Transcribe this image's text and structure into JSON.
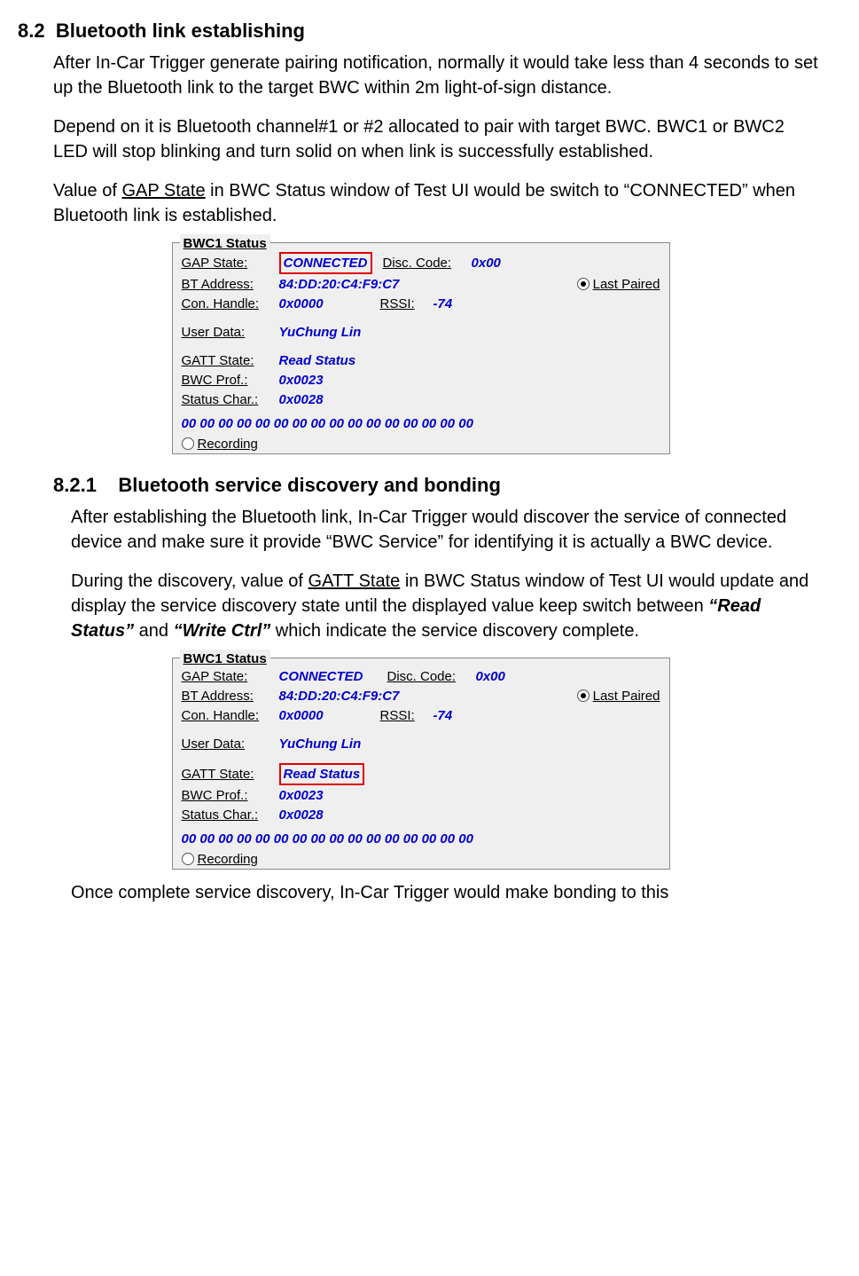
{
  "sections": {
    "s82_num": "8.2",
    "s82_title": "Bluetooth link establishing",
    "s82_p1": "After In-Car Trigger generate pairing notification, normally it would take less than 4 seconds to set up the Bluetooth link to the target BWC within 2m light-of-sign distance.",
    "s82_p2": "Depend on it is Bluetooth channel#1 or #2 allocated to pair with target BWC. BWC1 or BWC2 LED will stop blinking and turn solid on when link is successfully established.",
    "s82_p3a": "Value of ",
    "s82_p3_gap": "GAP State",
    "s82_p3b": " in BWC Status window of Test UI would be switch to “CONNECTED” when Bluetooth link is established.",
    "s821_num": "8.2.1",
    "s821_title": "Bluetooth service discovery and bonding",
    "s821_p1": "After establishing the Bluetooth link, In-Car Trigger would discover the service of connected device and make sure it provide “BWC Service” for identifying it is actually a BWC device.",
    "s821_p2a": "During the discovery, value of ",
    "s821_p2_gatt": "GATT State",
    "s821_p2b": " in BWC Status window of Test UI would update and display the service discovery state until the displayed value keep switch between ",
    "s821_p2_rs": "“Read Status”",
    "s821_p2c": " and ",
    "s821_p2_wc": "“Write Ctrl”",
    "s821_p2d": " which indicate the service discovery complete.",
    "s821_p3": "Once complete service discovery, In-Car Trigger would make bonding to this"
  },
  "panel": {
    "legend": "BWC1 Status",
    "labels": {
      "gap_state": "GAP State:",
      "disc_code": "Disc. Code:",
      "bt_address": "BT Address:",
      "last_paired": "Last Paired",
      "con_handle": "Con. Handle:",
      "rssi": "RSSI:",
      "user_data": "User Data:",
      "gatt_state": "GATT State:",
      "bwc_prof": "BWC Prof.:",
      "status_char": "Status Char.:",
      "recording": "Recording"
    },
    "values": {
      "gap_state": "CONNECTED",
      "disc_code": "0x00",
      "bt_address": "84:DD:20:C4:F9:C7",
      "con_handle": "0x0000",
      "rssi": "-74",
      "user_data": "YuChung Lin",
      "gatt_state": "Read Status",
      "bwc_prof": "0x0023",
      "status_char": "0x0028",
      "hexline": "00 00 00 00 00 00 00 00 00 00 00 00 00 00 00 00"
    }
  }
}
